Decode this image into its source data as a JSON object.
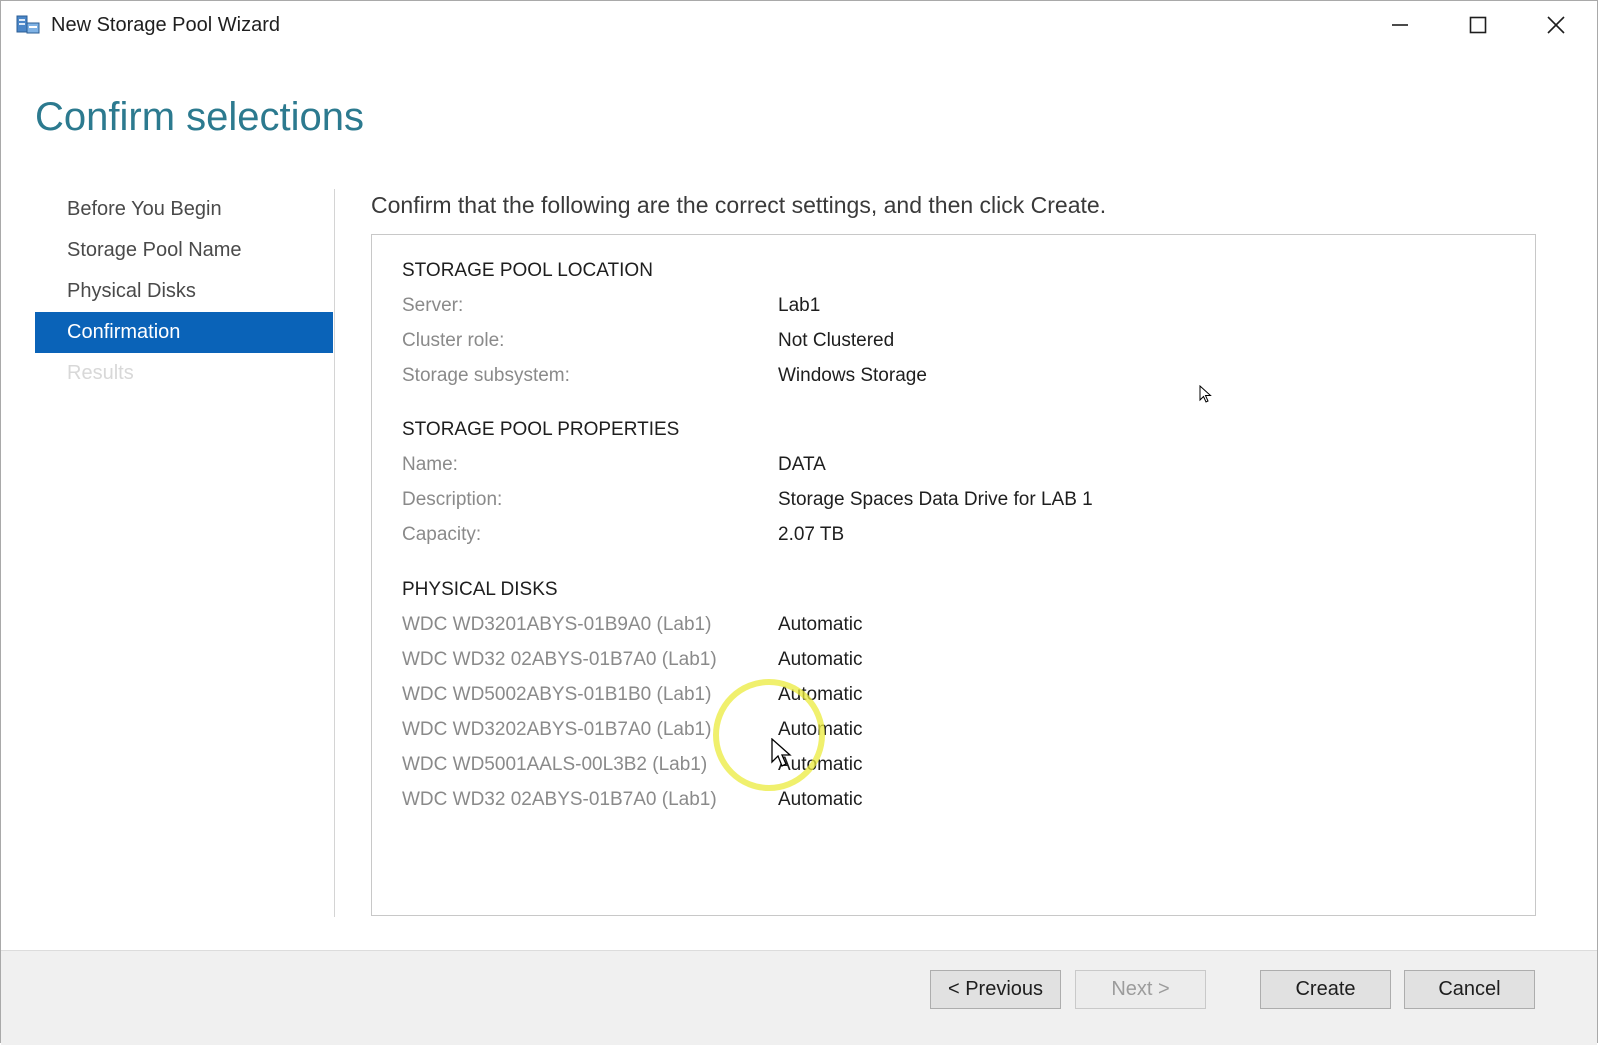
{
  "window": {
    "title": "New Storage Pool Wizard",
    "icon": "storage-pool-icon"
  },
  "heading": "Confirm selections",
  "nav": {
    "items": [
      {
        "label": "Before You Begin",
        "state": "normal"
      },
      {
        "label": "Storage Pool Name",
        "state": "normal"
      },
      {
        "label": "Physical Disks",
        "state": "normal"
      },
      {
        "label": "Confirmation",
        "state": "active"
      },
      {
        "label": "Results",
        "state": "disabled"
      }
    ]
  },
  "instruction": "Confirm that the following are the correct settings, and then click Create.",
  "summary": {
    "location": {
      "heading": "STORAGE POOL LOCATION",
      "rows": [
        {
          "label": "Server:",
          "value": "Lab1"
        },
        {
          "label": "Cluster role:",
          "value": "Not Clustered"
        },
        {
          "label": "Storage subsystem:",
          "value": "Windows Storage"
        }
      ]
    },
    "properties": {
      "heading": "STORAGE POOL PROPERTIES",
      "rows": [
        {
          "label": "Name:",
          "value": "DATA"
        },
        {
          "label": "Description:",
          "value": "Storage Spaces Data Drive for LAB 1"
        },
        {
          "label": "Capacity:",
          "value": "2.07 TB"
        }
      ]
    },
    "disks": {
      "heading": "PHYSICAL DISKS",
      "rows": [
        {
          "label": "WDC WD3201ABYS-01B9A0 (Lab1)",
          "value": "Automatic"
        },
        {
          "label": "WDC WD32 02ABYS-01B7A0 (Lab1)",
          "value": "Automatic"
        },
        {
          "label": "WDC WD5002ABYS-01B1B0 (Lab1)",
          "value": "Automatic"
        },
        {
          "label": "WDC WD3202ABYS-01B7A0 (Lab1)",
          "value": "Automatic"
        },
        {
          "label": "WDC WD5001AALS-00L3B2 (Lab1)",
          "value": "Automatic"
        },
        {
          "label": "WDC WD32 02ABYS-01B7A0 (Lab1)",
          "value": "Automatic"
        }
      ]
    }
  },
  "buttons": {
    "previous": "< Previous",
    "next": "Next >",
    "create": "Create",
    "cancel": "Cancel"
  },
  "colors": {
    "heading": "#2c7a8f",
    "nav_active": "#0a63b8",
    "cursor_highlight": "#ebeb3c"
  }
}
